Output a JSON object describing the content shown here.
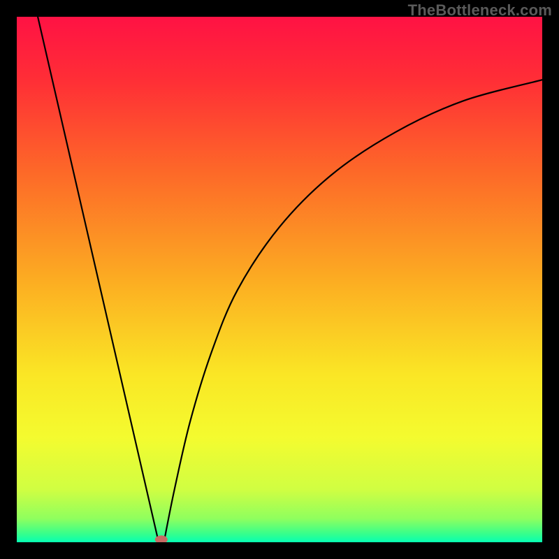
{
  "watermark": "TheBottleneck.com",
  "chart_data": {
    "type": "line",
    "title": "",
    "xlabel": "",
    "ylabel": "",
    "xlim": [
      0,
      100
    ],
    "ylim": [
      0,
      100
    ],
    "grid": false,
    "left_branch_endpoints": {
      "x_at_top": 4,
      "x_at_bottom": 27,
      "y_top": 100,
      "y_bottom": 0
    },
    "right_branch_samples": [
      {
        "x": 28,
        "y": 0
      },
      {
        "x": 30,
        "y": 10
      },
      {
        "x": 33,
        "y": 23
      },
      {
        "x": 37,
        "y": 36
      },
      {
        "x": 42,
        "y": 48
      },
      {
        "x": 50,
        "y": 60
      },
      {
        "x": 60,
        "y": 70
      },
      {
        "x": 72,
        "y": 78
      },
      {
        "x": 85,
        "y": 84
      },
      {
        "x": 100,
        "y": 88
      }
    ],
    "marker": {
      "x": 27.5,
      "y": 0.5,
      "color": "#c76b64"
    },
    "gradient_stops": [
      {
        "offset": 0.0,
        "color": "#ff1244"
      },
      {
        "offset": 0.12,
        "color": "#ff2e36"
      },
      {
        "offset": 0.3,
        "color": "#fd6a28"
      },
      {
        "offset": 0.5,
        "color": "#fcac22"
      },
      {
        "offset": 0.68,
        "color": "#fae625"
      },
      {
        "offset": 0.8,
        "color": "#f4fb2f"
      },
      {
        "offset": 0.9,
        "color": "#d0fe42"
      },
      {
        "offset": 0.955,
        "color": "#8fff5e"
      },
      {
        "offset": 0.985,
        "color": "#33ff8e"
      },
      {
        "offset": 1.0,
        "color": "#06ffb3"
      }
    ]
  }
}
